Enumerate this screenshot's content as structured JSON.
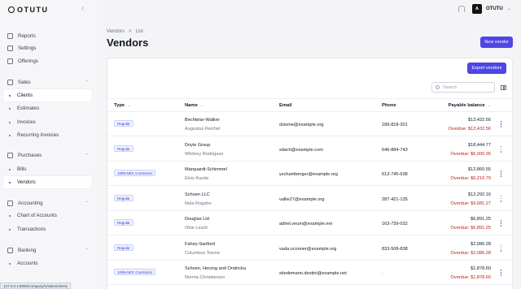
{
  "app": {
    "logo_text": "OTUTU"
  },
  "topbar": {
    "avatar_initial": "A",
    "user_name": "OTUTU"
  },
  "sidebar": {
    "items": [
      {
        "label": "Reports",
        "kind": "icon",
        "icon": "chart-icon",
        "active": false
      },
      {
        "label": "Settings",
        "kind": "icon",
        "icon": "gear-icon",
        "active": false
      },
      {
        "label": "Offerings",
        "kind": "icon",
        "icon": "box-icon",
        "active": false
      },
      {
        "label": "Sales",
        "kind": "section",
        "icon": "tag-icon",
        "active": false
      },
      {
        "label": "Clients",
        "kind": "sub",
        "active": true
      },
      {
        "label": "Estimates",
        "kind": "sub",
        "active": false
      },
      {
        "label": "Invoices",
        "kind": "sub",
        "active": false
      },
      {
        "label": "Recurring Invoices",
        "kind": "sub",
        "active": false
      },
      {
        "label": "Purchases",
        "kind": "section",
        "icon": "cart-icon",
        "active": false
      },
      {
        "label": "Bills",
        "kind": "sub",
        "active": false
      },
      {
        "label": "Vendors",
        "kind": "sub",
        "active": true
      },
      {
        "label": "Accounting",
        "kind": "section",
        "icon": "ledger-icon",
        "active": false
      },
      {
        "label": "Chart of Accounts",
        "kind": "sub",
        "active": false
      },
      {
        "label": "Transactions",
        "kind": "sub",
        "active": false
      },
      {
        "label": "Banking",
        "kind": "section",
        "icon": "bank-icon",
        "active": false
      },
      {
        "label": "Accounts",
        "kind": "sub",
        "active": false
      }
    ]
  },
  "status_bar": {
    "url": "127.0.0.1:8000/company/1/sales/clients"
  },
  "header": {
    "breadcrumb": [
      "Vendors",
      ">",
      "List"
    ],
    "title": "Vendors",
    "new_button": "New vendor"
  },
  "toolbar": {
    "export_button": "Export vendors",
    "search_placeholder": "Search"
  },
  "table": {
    "columns": [
      "Type",
      "Name",
      "Email",
      "Phone",
      "Payable balance"
    ],
    "rows": [
      {
        "type": "Regular",
        "name": "Bechtelar-Walker",
        "contact": "Augustus Reichel",
        "email": "dzieme@example.org",
        "phone": "189-818-301",
        "balance": "$13,432.56",
        "overdue": "Overdue: $13,432.56"
      },
      {
        "type": "Regular",
        "name": "Doyle Group",
        "contact": "Whitney Rodriguez",
        "email": "xdach@example.com",
        "phone": "646-884-743",
        "balance": "$18,444.77",
        "overdue": "Overdue: $6,000.35"
      },
      {
        "type": "1099-NEC Contractor",
        "name": "Marquardt-Schimmel",
        "contact": "Elvis Kunde",
        "email": "yschamberger@example.org",
        "phone": "613-745-638",
        "balance": "$12,860.55",
        "overdue": "Overdue: $6,210.79"
      },
      {
        "type": "Regular",
        "name": "Schoen LLC",
        "contact": "Nola Rogahn",
        "email": "vallie27@example.org",
        "phone": "287-421-135",
        "balance": "$12,292.16",
        "overdue": "Overdue: $9,581.27"
      },
      {
        "type": "Regular",
        "name": "Douglas Ltd",
        "contact": "Obie Lesch",
        "email": "adriel.veum@example.net",
        "phone": "163-739-032",
        "balance": "$6,891.25",
        "overdue": "Overdue: $6,891.25"
      },
      {
        "type": "Regular",
        "name": "Fahey-Sanford",
        "contact": "Columbus Towne",
        "email": "vada.oconner@example.org",
        "phone": "833-508-838",
        "balance": "$2,086.28",
        "overdue": "Overdue: $2,086.28"
      },
      {
        "type": "1099-NEC Contractor",
        "name": "Schoen, Herzog and Ondricka",
        "contact": "Norma Christiansen",
        "email": "stiedemann.destini@example.net",
        "phone": "-",
        "balance": "$1,878.60",
        "overdue": "Overdue: $1,878.60"
      }
    ]
  }
}
